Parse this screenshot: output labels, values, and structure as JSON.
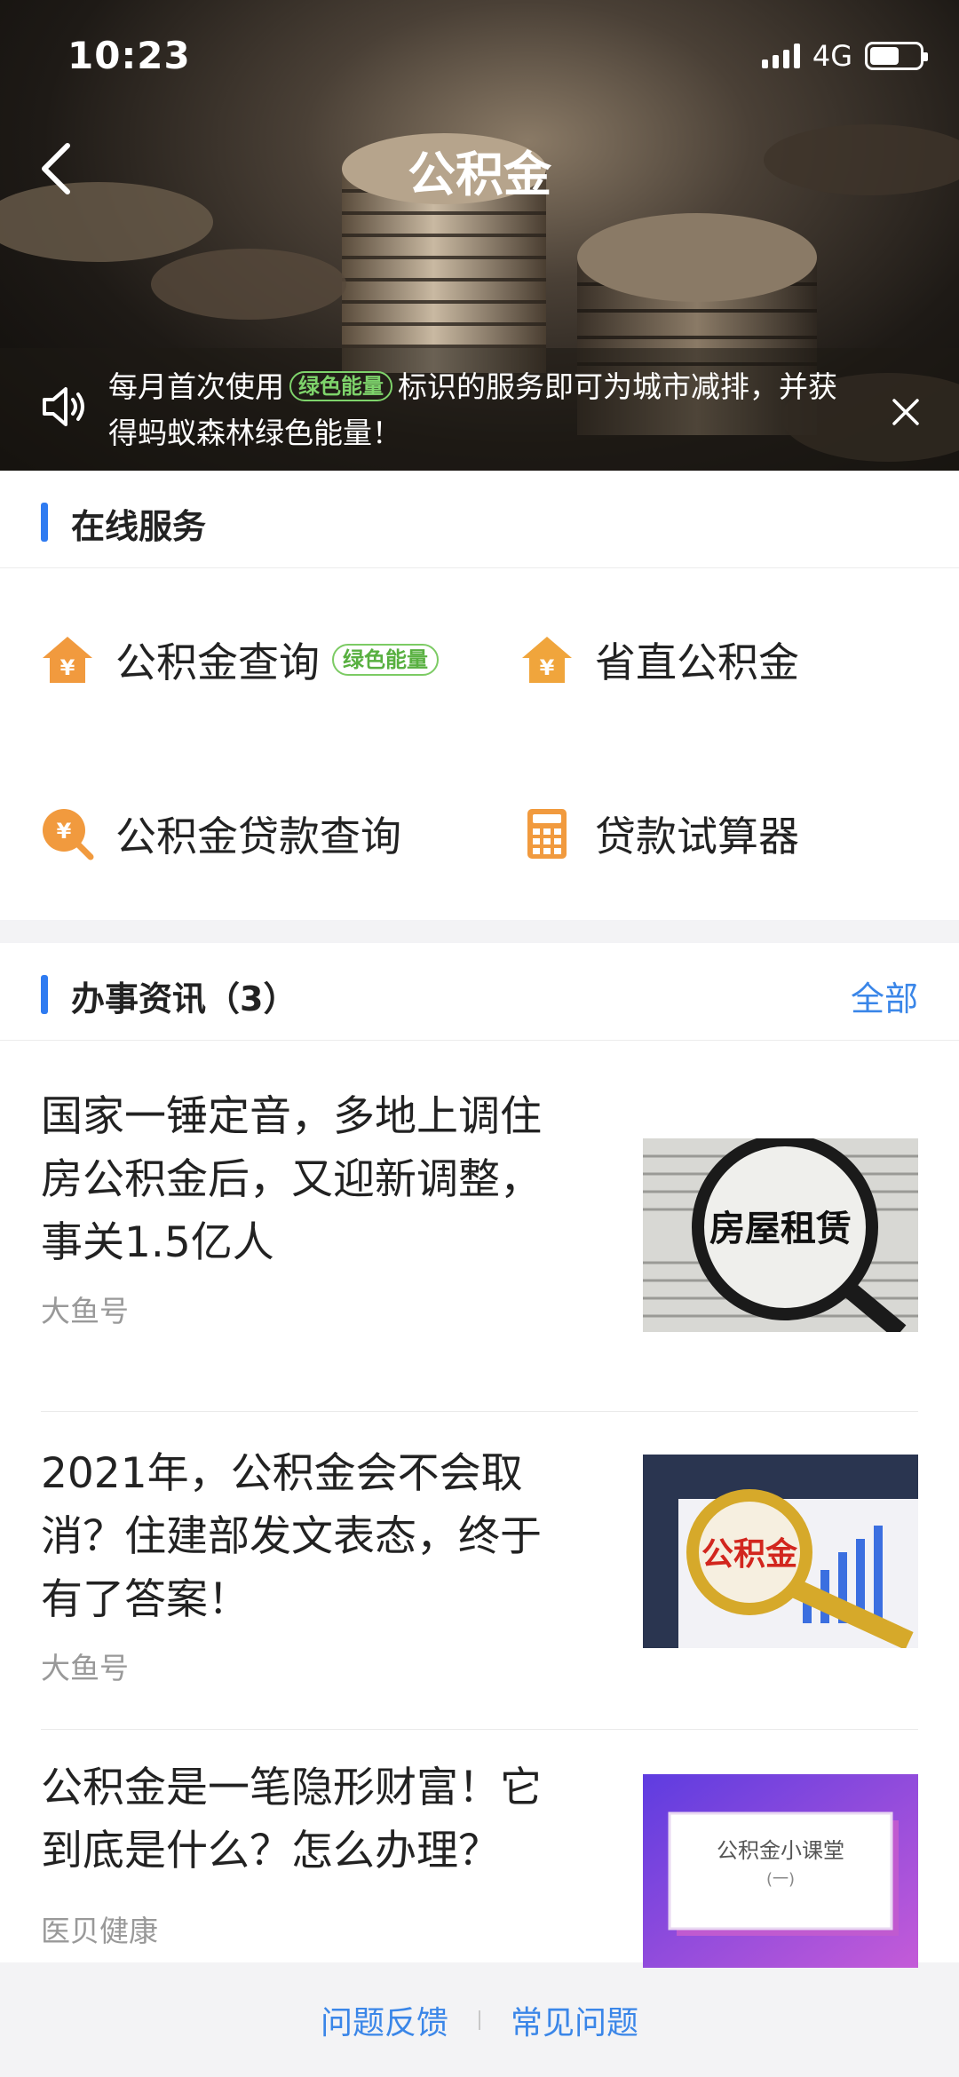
{
  "status_bar": {
    "time": "10:23",
    "network": "4G"
  },
  "nav": {
    "title": "公积金"
  },
  "notice": {
    "text_before": "每月首次使用",
    "tag": "绿色能量",
    "text_after": "标识的服务即可为城市减排，并获得蚂蚁森林绿色能量！"
  },
  "online_services": {
    "title": "在线服务",
    "items": [
      {
        "label": "公积金查询",
        "tag": "绿色能量",
        "icon": "house-yen-icon"
      },
      {
        "label": "省直公积金",
        "icon": "house-yen-icon"
      },
      {
        "label": "公积金贷款查询",
        "icon": "search-yen-icon"
      },
      {
        "label": "贷款试算器",
        "icon": "calculator-icon"
      }
    ]
  },
  "news": {
    "title": "办事资讯（3）",
    "all_link": "全部",
    "items": [
      {
        "title": "国家一锤定音，多地上调住房公积金后，又迎新调整，事关1.5亿人",
        "source": "大鱼号",
        "image_caption": "房屋租赁"
      },
      {
        "title": "2021年，公积金会不会取消？住建部发文表态，终于有了答案！",
        "source": "大鱼号",
        "image_caption": "公积金"
      },
      {
        "title": "公积金是一笔隐形财富！它到底是什么？怎么办理？",
        "source": "医贝健康",
        "image_caption": "公积金小课堂",
        "image_subcaption": "(一)"
      }
    ]
  },
  "footer": {
    "feedback": "问题反馈",
    "faq": "常见问题"
  },
  "colors": {
    "accent_blue": "#2f7bf1",
    "link_blue": "#3a86e8",
    "icon_orange": "#f19a3e",
    "green_tag": "#7ed36b"
  }
}
